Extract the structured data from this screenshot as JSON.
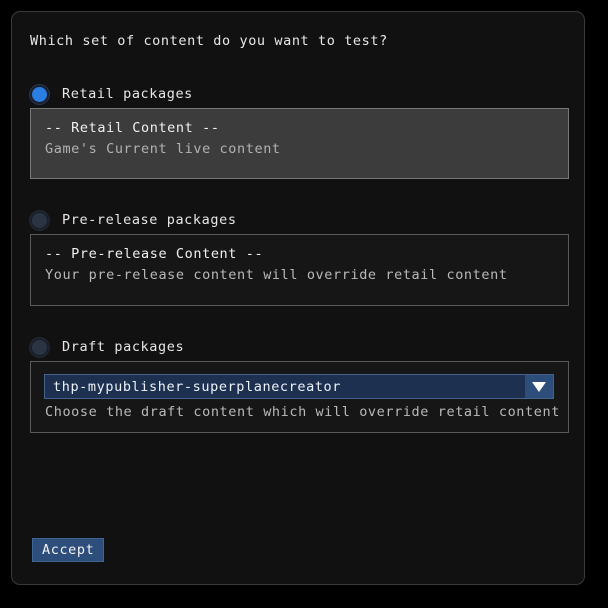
{
  "dialog": {
    "question": "Which set of content do you want to test?",
    "accept_label": "Accept"
  },
  "options": [
    {
      "id": "retail",
      "radio_label": "Retail packages",
      "selected": true,
      "box_title": "-- Retail Content --",
      "box_desc": "Game's Current live content"
    },
    {
      "id": "prerelease",
      "radio_label": "Pre-release packages",
      "selected": false,
      "box_title": "-- Pre-release Content --",
      "box_desc": "Your pre-release content will override retail content"
    },
    {
      "id": "draft",
      "radio_label": "Draft packages",
      "selected": false,
      "box_desc": "Choose the draft content which will override retail content",
      "dropdown": {
        "value": "thp-mypublisher-superplanecreator",
        "arrow_icon": "chevron-down-icon"
      }
    }
  ],
  "colors": {
    "panel_bg": "#111111",
    "panel_border": "#3a3a3a",
    "selected_box_bg": "#3c3c3c",
    "radio_on": "#2a7de1",
    "radio_off": "#2b3442",
    "accent_blue": "#2d4d7a",
    "dropdown_bg": "#1d3050",
    "text_primary": "#e8e8e8",
    "text_secondary": "#b9b9b9"
  }
}
